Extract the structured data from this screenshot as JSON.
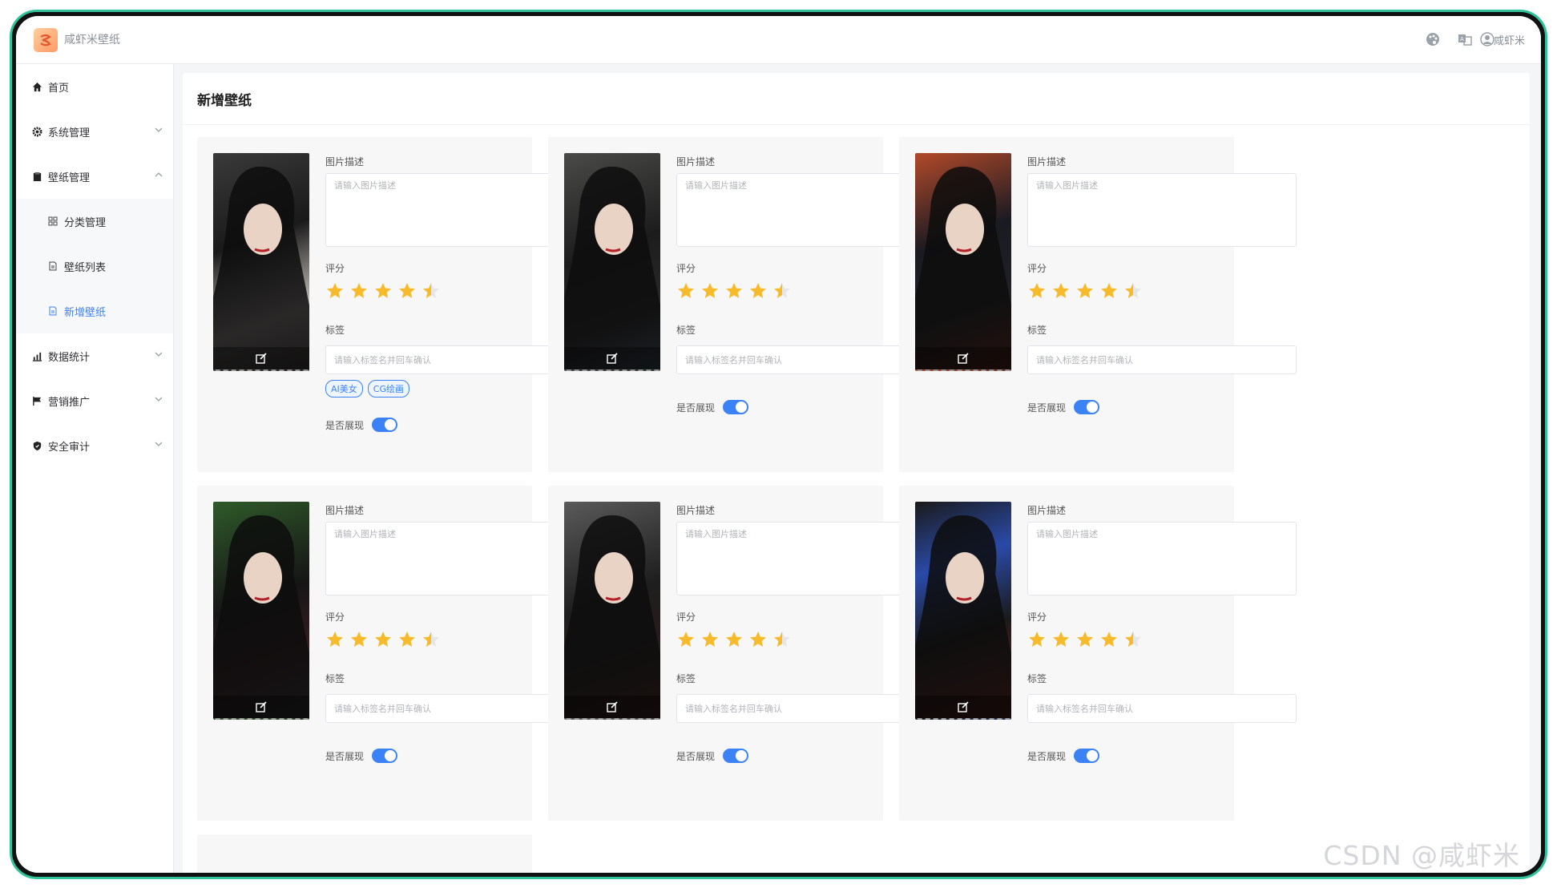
{
  "app": {
    "title": "咸虾米壁纸",
    "user": "咸虾米"
  },
  "header_icons": [
    "palette-icon",
    "translate-icon",
    "user-icon"
  ],
  "sidebar": {
    "items": [
      {
        "label": "首页",
        "icon": "home-icon",
        "expandable": false
      },
      {
        "label": "系统管理",
        "icon": "gear-icon",
        "expandable": true,
        "expanded": false
      },
      {
        "label": "壁纸管理",
        "icon": "clipboard-icon",
        "expandable": true,
        "expanded": true,
        "children": [
          {
            "label": "分类管理",
            "icon": "grid-icon",
            "active": false
          },
          {
            "label": "壁纸列表",
            "icon": "document-icon",
            "active": false
          },
          {
            "label": "新增壁纸",
            "icon": "document-icon",
            "active": true
          }
        ]
      },
      {
        "label": "数据统计",
        "icon": "chart-icon",
        "expandable": true,
        "expanded": false
      },
      {
        "label": "营销推广",
        "icon": "flag-icon",
        "expandable": true,
        "expanded": false
      },
      {
        "label": "安全审计",
        "icon": "shield-icon",
        "expandable": true,
        "expanded": false
      }
    ]
  },
  "main": {
    "title": "新增壁纸",
    "field_labels": {
      "description": "图片描述",
      "rating": "评分",
      "tags": "标签",
      "show": "是否展现"
    },
    "placeholders": {
      "description": "请输入图片描述",
      "tags": "请输入标签名并回车确认"
    },
    "cards": [
      {
        "rating": 4.5,
        "tags": [
          "AI美女",
          "CG绘画"
        ],
        "show": true
      },
      {
        "rating": 4.5,
        "tags": [],
        "show": true
      },
      {
        "rating": 4.5,
        "tags": [],
        "show": true
      },
      {
        "rating": 4.5,
        "tags": [],
        "show": true
      },
      {
        "rating": 4.5,
        "tags": [],
        "show": true
      },
      {
        "rating": 4.5,
        "tags": [],
        "show": true
      }
    ]
  },
  "watermark": "CSDN @咸虾米",
  "colors": {
    "accent": "#3b82f6",
    "star": "#f7ba2a",
    "frame": "#2ec39a"
  }
}
